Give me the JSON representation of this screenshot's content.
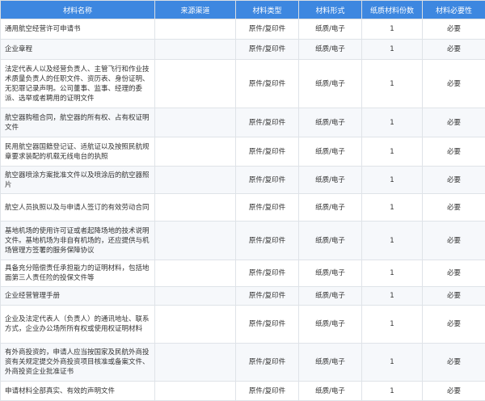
{
  "columns": [
    "材料名称",
    "来源渠道",
    "材料类型",
    "材料形式",
    "纸质材料份数",
    "材料必要性"
  ],
  "rows": [
    {
      "name": "通用航空经营许可申请书",
      "source": "",
      "type": "原件/复印件",
      "form": "纸质/电子",
      "copies": "1",
      "necessity": "必要"
    },
    {
      "name": "企业章程",
      "source": "",
      "type": "原件/复印件",
      "form": "纸质/电子",
      "copies": "1",
      "necessity": "必要"
    },
    {
      "name": "法定代表人以及经营负责人、主管飞行和作业技术质量负责人的任职文件、资历表、身份证明、无犯罪记录声明。公司董事、监事、经理的委派、选举或者聘用的证明文件",
      "source": "",
      "type": "原件/复印件",
      "form": "纸质/电子",
      "copies": "1",
      "necessity": "必要"
    },
    {
      "name": "航空器购租合同，航空器的所有权、占有权证明文件",
      "source": "",
      "type": "原件/复印件",
      "form": "纸质/电子",
      "copies": "1",
      "necessity": "必要"
    },
    {
      "name": "民用航空器国籍登记证、适航证以及按照民航规章要求装配的机载无线电台的执照",
      "source": "",
      "type": "原件/复印件",
      "form": "纸质/电子",
      "copies": "1",
      "necessity": "必要"
    },
    {
      "name": "航空器喷涂方案批准文件以及喷涂后的航空器照片",
      "source": "",
      "type": "原件/复印件",
      "form": "纸质/电子",
      "copies": "1",
      "necessity": "必要"
    },
    {
      "name": "航空人员执照以及与申请人签订的有效劳动合同",
      "source": "",
      "type": "原件/复印件",
      "form": "纸质/电子",
      "copies": "1",
      "necessity": "必要"
    },
    {
      "name": "基地机场的使用许可证或者起降场地的技术说明文件。基地机场为非自有机场的，还应提供与机场管理方签署的服务保障协议",
      "source": "",
      "type": "原件/复印件",
      "form": "纸质/电子",
      "copies": "1",
      "necessity": "必要"
    },
    {
      "name": "具备充分赔偿责任承担能力的证明材料，包括地面第三人责任险的投保文件等",
      "source": "",
      "type": "原件/复印件",
      "form": "纸质/电子",
      "copies": "1",
      "necessity": "必要"
    },
    {
      "name": "企业经营管理手册",
      "source": "",
      "type": "原件/复印件",
      "form": "纸质/电子",
      "copies": "1",
      "necessity": "必要"
    },
    {
      "name": "企业及法定代表人（负责人）的通讯地址、联系方式，企业办公场所所有权或使用权证明材料",
      "source": "",
      "type": "原件/复印件",
      "form": "纸质/电子",
      "copies": "1",
      "necessity": "必要"
    },
    {
      "name": "有外商投资的，申请人应当按国家及民航外商投资有关规定提交外商投资项目核准或备案文件、外商投资企业批准证书",
      "source": "",
      "type": "原件/复印件",
      "form": "纸质/电子",
      "copies": "1",
      "necessity": "必要"
    },
    {
      "name": "申请材料全部真实、有效的声明文件",
      "source": "",
      "type": "原件/复印件",
      "form": "纸质/电子",
      "copies": "1",
      "necessity": "必要"
    }
  ]
}
